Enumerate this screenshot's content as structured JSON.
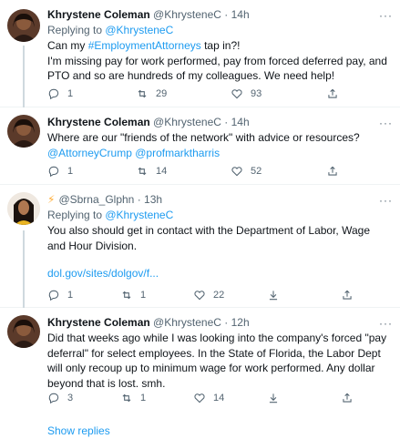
{
  "tweets": [
    {
      "name": "Khrystene Coleman",
      "handle": "@KhrysteneC",
      "time": "· 14h",
      "replying_prefix": "Replying to ",
      "replying_to": "@KhrysteneC",
      "text_pre": "Can my ",
      "hashtag": "#EmploymentAttorneys",
      "text_post": " tap in?!",
      "text_line2": "I'm missing pay for work performed, pay from forced deferred pay, and PTO and so are hundreds of my colleagues. We need help!",
      "replies": "1",
      "retweets": "29",
      "likes": "93"
    },
    {
      "name": "Khrystene Coleman",
      "handle": "@KhrysteneC",
      "time": "· 14h",
      "text": "Where are our \"friends of the network\" with advice or resources?",
      "mention1": "@AttorneyCrump",
      "mention2": "@profmarktharris",
      "replies": "1",
      "retweets": "14",
      "likes": "52"
    },
    {
      "handle": "@Sbrna_Glphn",
      "time": "· 13h",
      "replying_prefix": "Replying to ",
      "replying_to": "@KhrysteneC",
      "text": "You also should get in contact with the Department of Labor, Wage and Hour Division.",
      "link": "dol.gov/sites/dolgov/f...",
      "replies": "1",
      "retweets": "1",
      "likes": "22"
    },
    {
      "name": "Khrystene Coleman",
      "handle": "@KhrysteneC",
      "time": "· 12h",
      "text": "Did that weeks ago while I was looking into the company's forced \"pay deferral\" for select employees. In the State of Florida, the Labor Dept will only recoup up to minimum wage for work performed. Any dollar beyond that is lost. smh.",
      "replies": "3",
      "retweets": "1",
      "likes": "14"
    }
  ],
  "show_replies": "Show replies",
  "colors": {
    "link": "#1d9bf0",
    "muted": "#536471",
    "divider": "#eff3f4"
  },
  "icons": [
    "reply-icon",
    "retweet-icon",
    "like-icon",
    "share-icon",
    "lightning-icon",
    "more-icon"
  ]
}
